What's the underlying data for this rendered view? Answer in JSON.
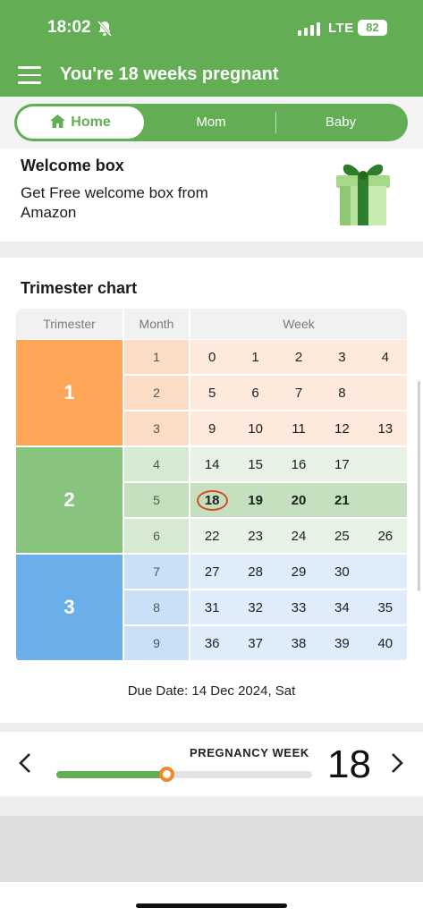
{
  "status_bar": {
    "time": "18:02",
    "network": "LTE",
    "battery": "82"
  },
  "app_bar": {
    "title": "You're 18 weeks pregnant"
  },
  "tabs": [
    {
      "label": "Home",
      "active": true
    },
    {
      "label": "Mom",
      "active": false
    },
    {
      "label": "Baby",
      "active": false
    }
  ],
  "welcome_box": {
    "title": "Welcome box",
    "text": "Get Free welcome box from Amazon"
  },
  "trimester_chart": {
    "title": "Trimester chart",
    "headers": {
      "trimester": "Trimester",
      "month": "Month",
      "week": "Week"
    },
    "trimesters": [
      {
        "label": "1",
        "color": "#fda658",
        "month_bg": "#fddcc6",
        "week_bg": "#fdeadd"
      },
      {
        "label": "2",
        "color": "#88c47e",
        "month_bg": "#d6ead1",
        "week_bg": "#e7f2e4"
      },
      {
        "label": "3",
        "color": "#6aaeea",
        "month_bg": "#c9e0f6",
        "week_bg": "#dfedfb"
      }
    ],
    "months": [
      {
        "month": "1",
        "weeks": [
          "0",
          "1",
          "2",
          "3",
          "4"
        ]
      },
      {
        "month": "2",
        "weeks": [
          "5",
          "6",
          "7",
          "8",
          ""
        ]
      },
      {
        "month": "3",
        "weeks": [
          "9",
          "10",
          "11",
          "12",
          "13"
        ]
      },
      {
        "month": "4",
        "weeks": [
          "14",
          "15",
          "16",
          "17",
          ""
        ]
      },
      {
        "month": "5",
        "weeks": [
          "18",
          "19",
          "20",
          "21",
          ""
        ],
        "current": true
      },
      {
        "month": "6",
        "weeks": [
          "22",
          "23",
          "24",
          "25",
          "26"
        ]
      },
      {
        "month": "7",
        "weeks": [
          "27",
          "28",
          "29",
          "30",
          ""
        ]
      },
      {
        "month": "8",
        "weeks": [
          "31",
          "32",
          "33",
          "34",
          "35"
        ]
      },
      {
        "month": "9",
        "weeks": [
          "36",
          "37",
          "38",
          "39",
          "40"
        ]
      }
    ],
    "current_week": "18",
    "current_row_color": "#c5e0bf",
    "due_date": "Due Date: 14 Dec 2024, Sat"
  },
  "pregnancy_week": {
    "label": "PREGNANCY WEEK",
    "value": "18",
    "progress": 0.43
  }
}
